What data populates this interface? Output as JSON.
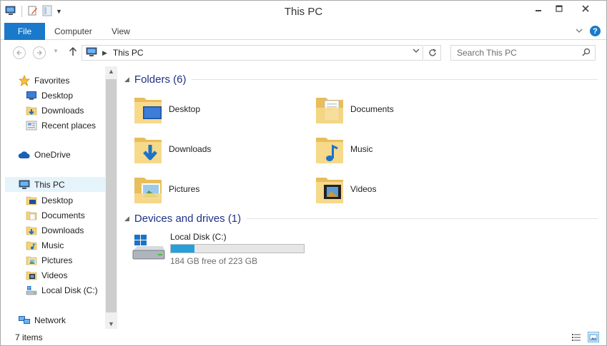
{
  "window": {
    "title": "This PC"
  },
  "ribbon": {
    "tabs": [
      "File",
      "Computer",
      "View"
    ]
  },
  "navbar": {
    "breadcrumb": "This PC",
    "search_placeholder": "Search This PC"
  },
  "sidebar": {
    "favorites": {
      "label": "Favorites",
      "items": [
        "Desktop",
        "Downloads",
        "Recent places"
      ]
    },
    "onedrive": "OneDrive",
    "thispc": {
      "label": "This PC",
      "items": [
        "Desktop",
        "Documents",
        "Downloads",
        "Music",
        "Pictures",
        "Videos",
        "Local Disk (C:)"
      ]
    },
    "network": "Network"
  },
  "main": {
    "folders_header": "Folders (6)",
    "folders": [
      "Desktop",
      "Documents",
      "Downloads",
      "Music",
      "Pictures",
      "Videos"
    ],
    "devices_header": "Devices and drives (1)",
    "drive": {
      "name": "Local Disk (C:)",
      "free_text": "184 GB free of 223 GB",
      "used_fraction": 0.175
    }
  },
  "status": {
    "count": "7 items"
  },
  "colors": {
    "accent": "#1979ca",
    "group_header": "#1e3287",
    "drive_bar": "#26a0da",
    "selected_bg": "#e5f3fb"
  }
}
